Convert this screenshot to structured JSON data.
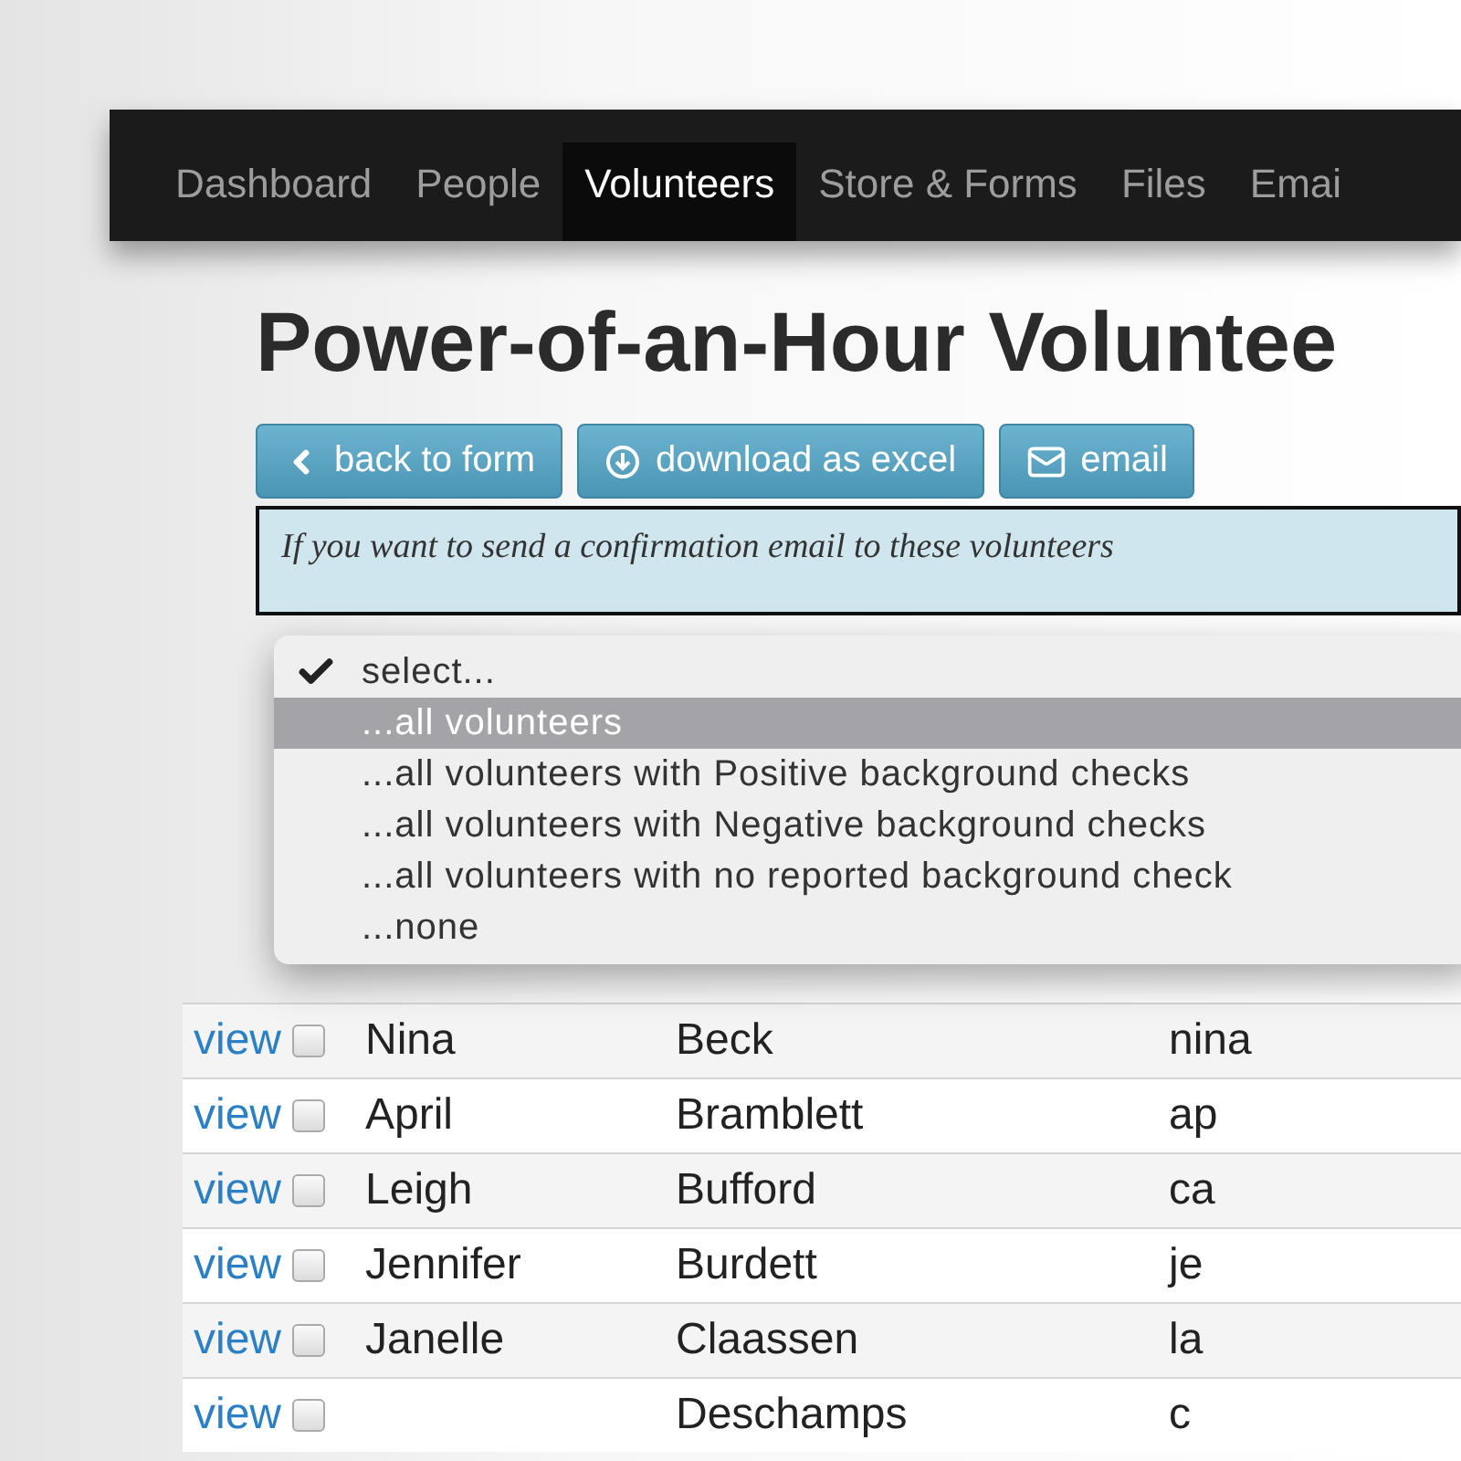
{
  "nav": {
    "items": [
      {
        "label": "Dashboard",
        "selected": false
      },
      {
        "label": "People",
        "selected": false
      },
      {
        "label": "Volunteers",
        "selected": true
      },
      {
        "label": "Store & Forms",
        "selected": false
      },
      {
        "label": "Files",
        "selected": false
      },
      {
        "label": "Emai",
        "selected": false
      }
    ]
  },
  "title": "Power-of-an-Hour Voluntee",
  "buttons": [
    {
      "label": "back to form",
      "kind": "back"
    },
    {
      "label": "download as excel",
      "kind": "download"
    },
    {
      "label": "email",
      "kind": "email"
    }
  ],
  "notice": "If you want to send a confirmation email to these volunteers",
  "dropdown": {
    "options": [
      {
        "label": "select...",
        "checked": true,
        "selected": false
      },
      {
        "label": "...all volunteers",
        "checked": false,
        "selected": true
      },
      {
        "label": "...all volunteers with Positive background checks",
        "checked": false,
        "selected": false
      },
      {
        "label": "...all volunteers with Negative background checks",
        "checked": false,
        "selected": false
      },
      {
        "label": "...all volunteers with no reported background check",
        "checked": false,
        "selected": false
      },
      {
        "label": "...none",
        "checked": false,
        "selected": false
      }
    ]
  },
  "table": {
    "rows": [
      {
        "link": "view",
        "checked": false,
        "first": "Nina",
        "last": "Beck",
        "email": "nina"
      },
      {
        "link": "view",
        "checked": false,
        "first": "April",
        "last": "Bramblett",
        "email": "ap"
      },
      {
        "link": "view",
        "checked": false,
        "first": "Leigh",
        "last": "Bufford",
        "email": "ca"
      },
      {
        "link": "view",
        "checked": false,
        "first": "Jennifer",
        "last": "Burdett",
        "email": "je"
      },
      {
        "link": "view",
        "checked": false,
        "first": "Janelle",
        "last": "Claassen",
        "email": "la"
      },
      {
        "link": "view",
        "checked": false,
        "last": "Deschamps",
        "email": "c"
      }
    ]
  }
}
